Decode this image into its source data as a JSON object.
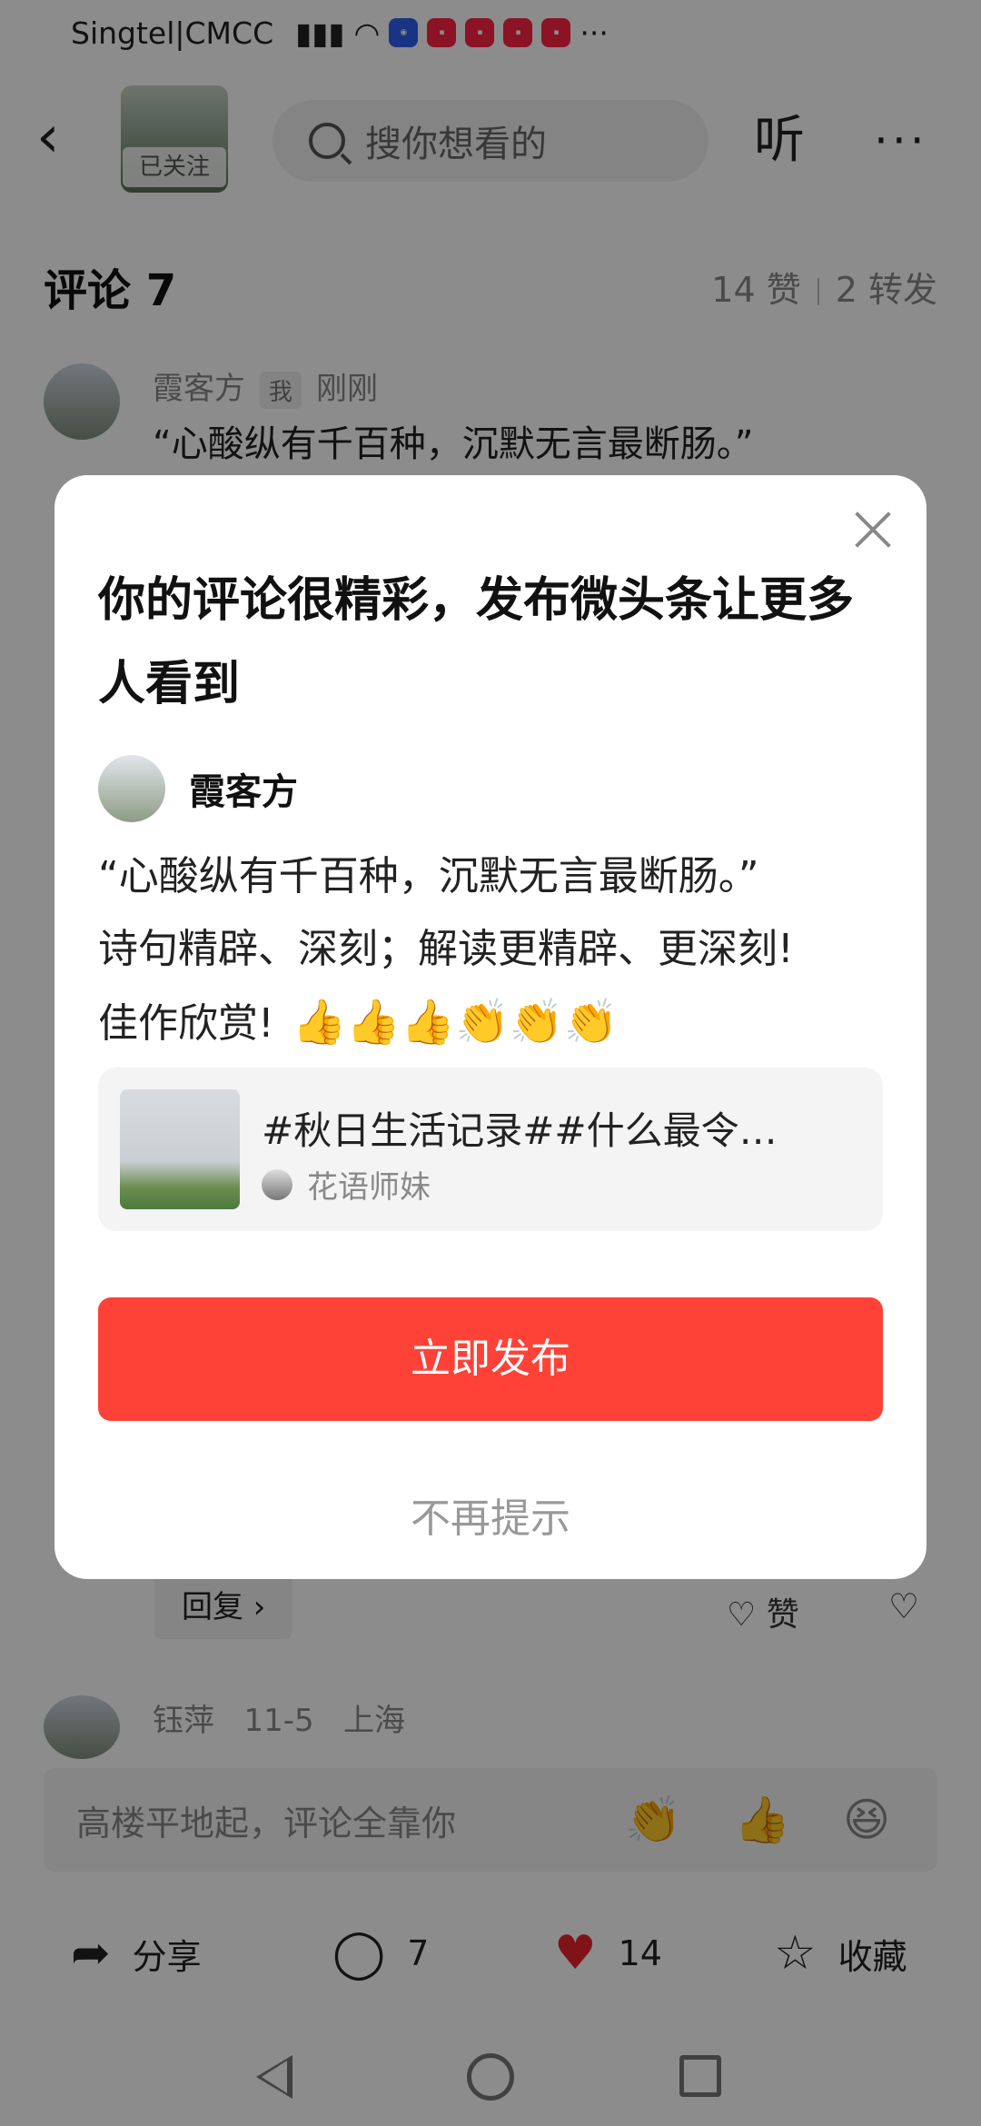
{
  "status_bar": {
    "carrier": "Singtel|CMCC",
    "more": "···"
  },
  "header": {
    "follow_label": "已关注",
    "search_placeholder": "搜你想看的",
    "listen_label": "听",
    "more_label": "···"
  },
  "comments": {
    "title": "评论 7",
    "likes": "14 赞",
    "shares": "2 转发",
    "first": {
      "name": "霞客方",
      "me_tag": "我",
      "time": "刚刚",
      "text": "“心酸纵有千百种，沉默无言最断肠。”"
    },
    "reply_label": "回复 ›",
    "like_label": "赞",
    "last": {
      "name": "钰萍",
      "time": "11-5",
      "location": "上海"
    }
  },
  "dialog": {
    "title": "你的评论很精彩，发布微头条让更多人看到",
    "author": "霞客方",
    "body_lines": [
      "“心酸纵有千百种，沉默无言最断肠。”",
      "诗句精辟、深刻；解读更精辟、更深刻!",
      "佳作欣赏!"
    ],
    "emojis": "👍👍👍👏👏👏",
    "article_title": "#秋日生活记录##什么最令…",
    "article_source": "花语师妹",
    "publish_label": "立即发布",
    "dismiss_label": "不再提示"
  },
  "input_bar": {
    "placeholder": "高楼平地起，评论全靠你",
    "emoji_1": "👏",
    "emoji_2": "👍",
    "emoji_3": "😆"
  },
  "bottom_bar": {
    "share": "分享",
    "comments": "7",
    "likes": "14",
    "favorite": "收藏"
  },
  "colors": {
    "accent": "#ff4237",
    "heart": "#e8242c"
  }
}
